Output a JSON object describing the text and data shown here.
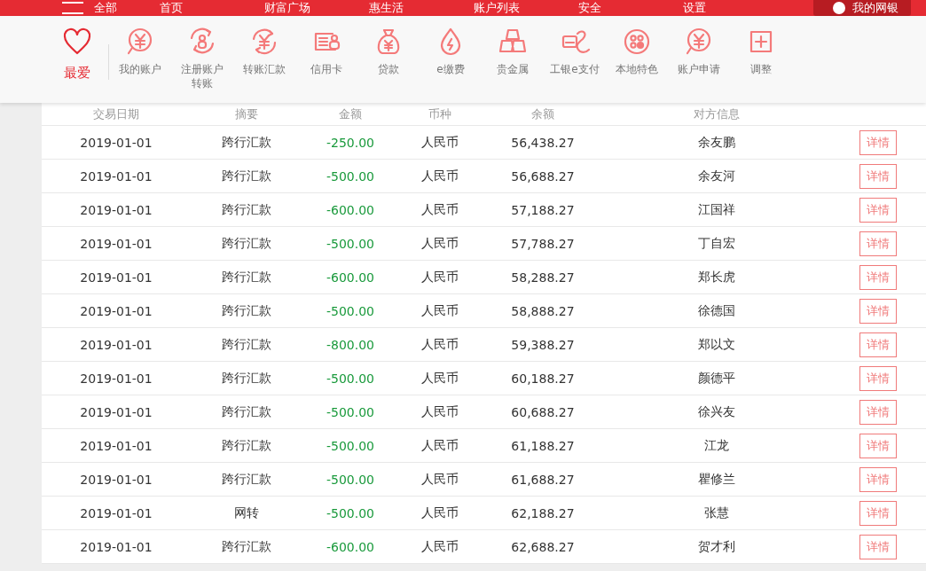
{
  "top_nav": {
    "menu_label": "全部",
    "items": [
      {
        "label": "首页"
      },
      {
        "label": "财富广场"
      },
      {
        "label": "惠生活"
      },
      {
        "label": "账户列表"
      },
      {
        "label": "安全"
      },
      {
        "label": "设置"
      }
    ],
    "my_bank": "我的网银"
  },
  "quick_menu": {
    "favorite": {
      "label": "最爱",
      "selected": true
    },
    "items": [
      {
        "label": "我的账户"
      },
      {
        "label": "注册账户转账"
      },
      {
        "label": "转账汇款"
      },
      {
        "label": "信用卡"
      },
      {
        "label": "贷款"
      },
      {
        "label": "e缴费"
      },
      {
        "label": "贵金属"
      },
      {
        "label": "工银e支付"
      },
      {
        "label": "本地特色"
      },
      {
        "label": "账户申请"
      },
      {
        "label": "调整"
      }
    ]
  },
  "table": {
    "columns": [
      "交易日期",
      "摘要",
      "金额",
      "币种",
      "余额",
      "对方信息"
    ],
    "rows": [
      {
        "date": "2019-01-01",
        "summary": "跨行汇款",
        "amount": "-250.00",
        "currency": "人民币",
        "balance": "56,438.27",
        "counterparty": "余友鹏",
        "action": "详情"
      },
      {
        "date": "2019-01-01",
        "summary": "跨行汇款",
        "amount": "-500.00",
        "currency": "人民币",
        "balance": "56,688.27",
        "counterparty": "余友河",
        "action": "详情"
      },
      {
        "date": "2019-01-01",
        "summary": "跨行汇款",
        "amount": "-600.00",
        "currency": "人民币",
        "balance": "57,188.27",
        "counterparty": "江国祥",
        "action": "详情"
      },
      {
        "date": "2019-01-01",
        "summary": "跨行汇款",
        "amount": "-500.00",
        "currency": "人民币",
        "balance": "57,788.27",
        "counterparty": "丁自宏",
        "action": "详情"
      },
      {
        "date": "2019-01-01",
        "summary": "跨行汇款",
        "amount": "-600.00",
        "currency": "人民币",
        "balance": "58,288.27",
        "counterparty": "郑长虎",
        "action": "详情"
      },
      {
        "date": "2019-01-01",
        "summary": "跨行汇款",
        "amount": "-500.00",
        "currency": "人民币",
        "balance": "58,888.27",
        "counterparty": "徐德国",
        "action": "详情"
      },
      {
        "date": "2019-01-01",
        "summary": "跨行汇款",
        "amount": "-800.00",
        "currency": "人民币",
        "balance": "59,388.27",
        "counterparty": "郑以文",
        "action": "详情"
      },
      {
        "date": "2019-01-01",
        "summary": "跨行汇款",
        "amount": "-500.00",
        "currency": "人民币",
        "balance": "60,188.27",
        "counterparty": "颜德平",
        "action": "详情"
      },
      {
        "date": "2019-01-01",
        "summary": "跨行汇款",
        "amount": "-500.00",
        "currency": "人民币",
        "balance": "60,688.27",
        "counterparty": "徐兴友",
        "action": "详情"
      },
      {
        "date": "2019-01-01",
        "summary": "跨行汇款",
        "amount": "-500.00",
        "currency": "人民币",
        "balance": "61,188.27",
        "counterparty": "江龙",
        "action": "详情"
      },
      {
        "date": "2019-01-01",
        "summary": "跨行汇款",
        "amount": "-500.00",
        "currency": "人民币",
        "balance": "61,688.27",
        "counterparty": "瞿修兰",
        "action": "详情"
      },
      {
        "date": "2019-01-01",
        "summary": "网转",
        "amount": "-500.00",
        "currency": "人民币",
        "balance": "62,188.27",
        "counterparty": "张慧",
        "action": "详情"
      },
      {
        "date": "2019-01-01",
        "summary": "跨行汇款",
        "amount": "-600.00",
        "currency": "人民币",
        "balance": "62,688.27",
        "counterparty": "贺才利",
        "action": "详情"
      }
    ]
  }
}
